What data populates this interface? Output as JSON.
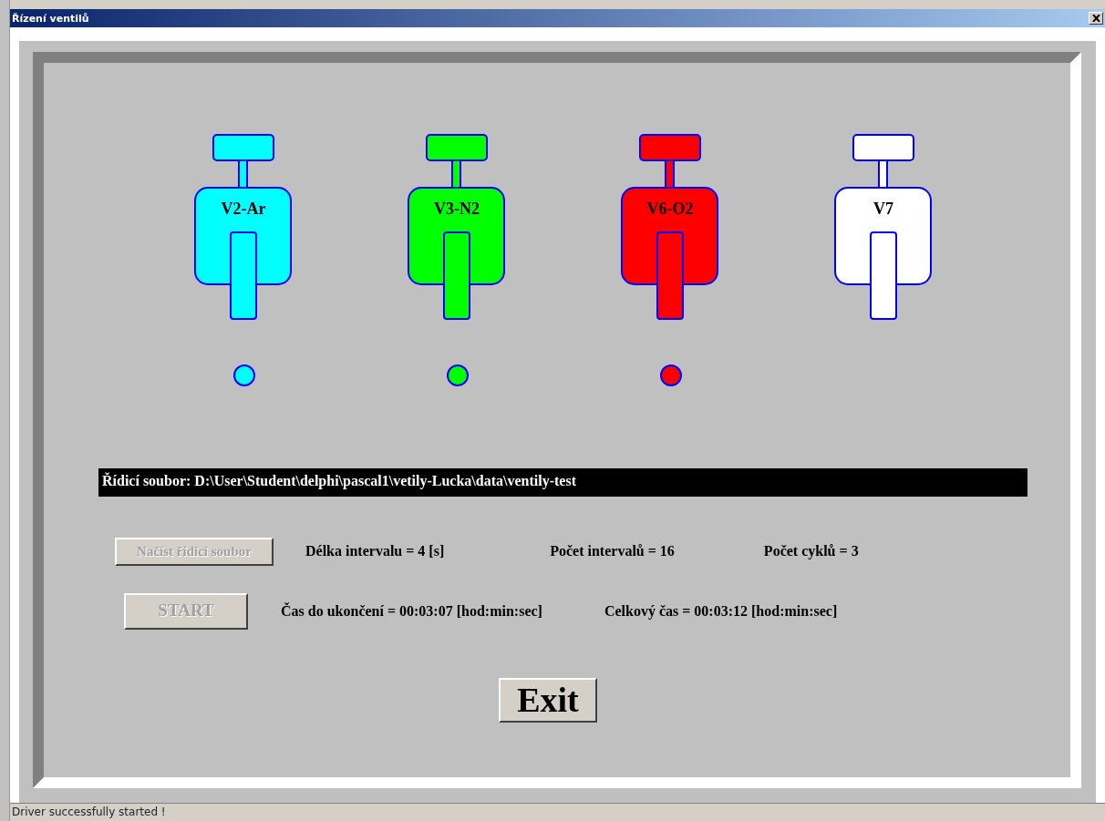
{
  "window": {
    "title": "Řízení ventilů"
  },
  "valves": [
    {
      "label": "V2-Ar",
      "color": "#00ffff",
      "indicator": true
    },
    {
      "label": "V3-N2",
      "color": "#00ff00",
      "indicator": true
    },
    {
      "label": "V6-O2",
      "color": "#ff0000",
      "indicator": true
    },
    {
      "label": "V7",
      "color": "#ffffff",
      "indicator": false
    }
  ],
  "control_file": "Řídicí soubor: D:\\User\\Student\\delphi\\pascal1\\vetily-Lucka\\data\\ventily-test",
  "load_button": {
    "label": "Načíst řídicí soubor",
    "disabled": true
  },
  "interval_length": "Délka intervalu = 4 [s]",
  "interval_count": "Počet intervalů = 16",
  "cycle_count": "Počet cyklů = 3",
  "start_button": {
    "label": "START",
    "disabled": true
  },
  "time_remaining": "Čas do ukončení = 00:03:07 [hod:min:sec]",
  "total_time": "Celkový čas = 00:03:12 [hod:min:sec]",
  "exit_button": {
    "label": "Exit",
    "disabled": false
  },
  "status_bar": "Driver successfully started !"
}
